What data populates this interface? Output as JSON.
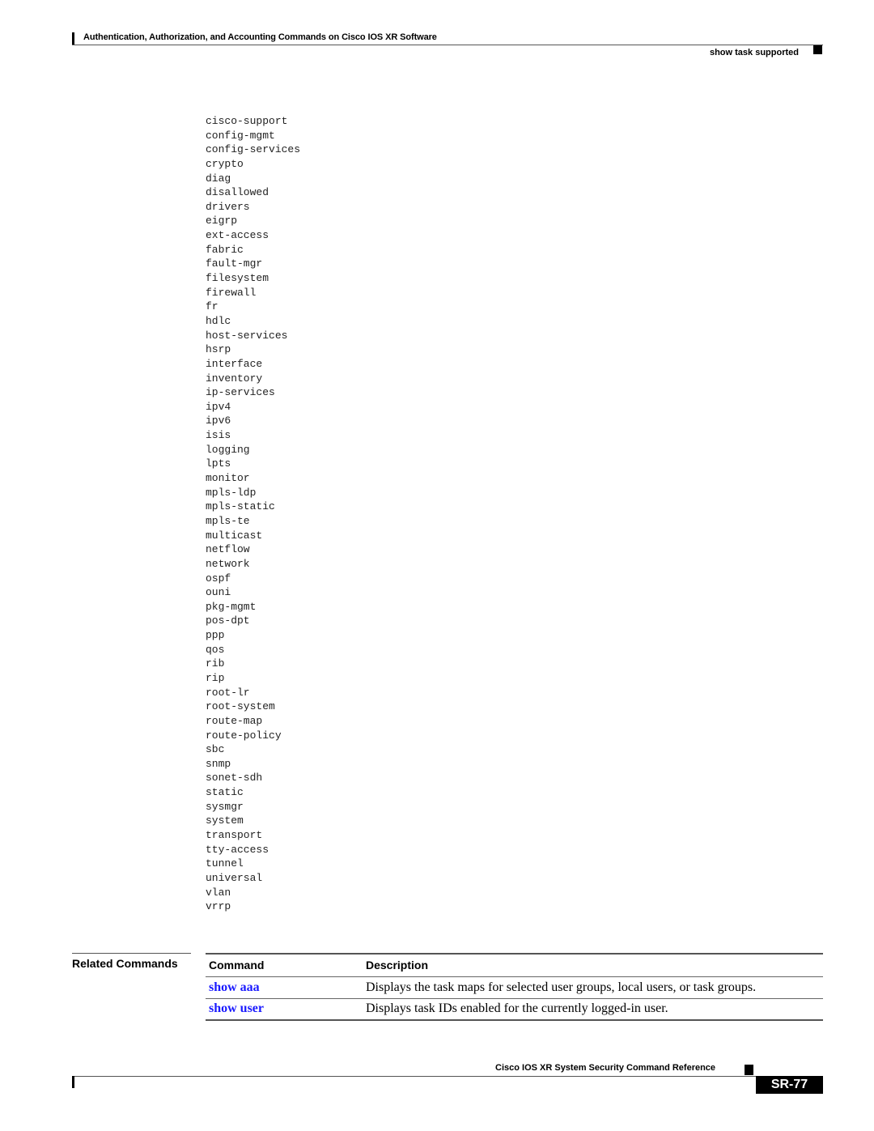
{
  "header": {
    "chapter_title": "Authentication, Authorization, and Accounting Commands on Cisco IOS XR Software",
    "section_title": "show task supported"
  },
  "task_ids": [
    "cisco-support",
    "config-mgmt",
    "config-services",
    "crypto",
    "diag",
    "disallowed",
    "drivers",
    "eigrp",
    "ext-access",
    "fabric",
    "fault-mgr",
    "filesystem",
    "firewall",
    "fr",
    "hdlc",
    "host-services",
    "hsrp",
    "interface",
    "inventory",
    "ip-services",
    "ipv4",
    "ipv6",
    "isis",
    "logging",
    "lpts",
    "monitor",
    "mpls-ldp",
    "mpls-static",
    "mpls-te",
    "multicast",
    "netflow",
    "network",
    "ospf",
    "ouni",
    "pkg-mgmt",
    "pos-dpt",
    "ppp",
    "qos",
    "rib",
    "rip",
    "root-lr",
    "root-system",
    "route-map",
    "route-policy",
    "sbc",
    "snmp",
    "sonet-sdh",
    "static",
    "sysmgr",
    "system",
    "transport",
    "tty-access",
    "tunnel",
    "universal",
    "vlan",
    "vrrp"
  ],
  "related_commands": {
    "label": "Related Commands",
    "columns": [
      "Command",
      "Description"
    ],
    "rows": [
      {
        "command": "show aaa",
        "description": "Displays the task maps for selected user groups, local users, or task groups."
      },
      {
        "command": "show user",
        "description": "Displays task IDs enabled for the currently logged-in user."
      }
    ],
    "link_color": "#1a1aff"
  },
  "footer": {
    "book_title": "Cisco IOS XR System Security Command Reference",
    "page_number": "SR-77"
  }
}
